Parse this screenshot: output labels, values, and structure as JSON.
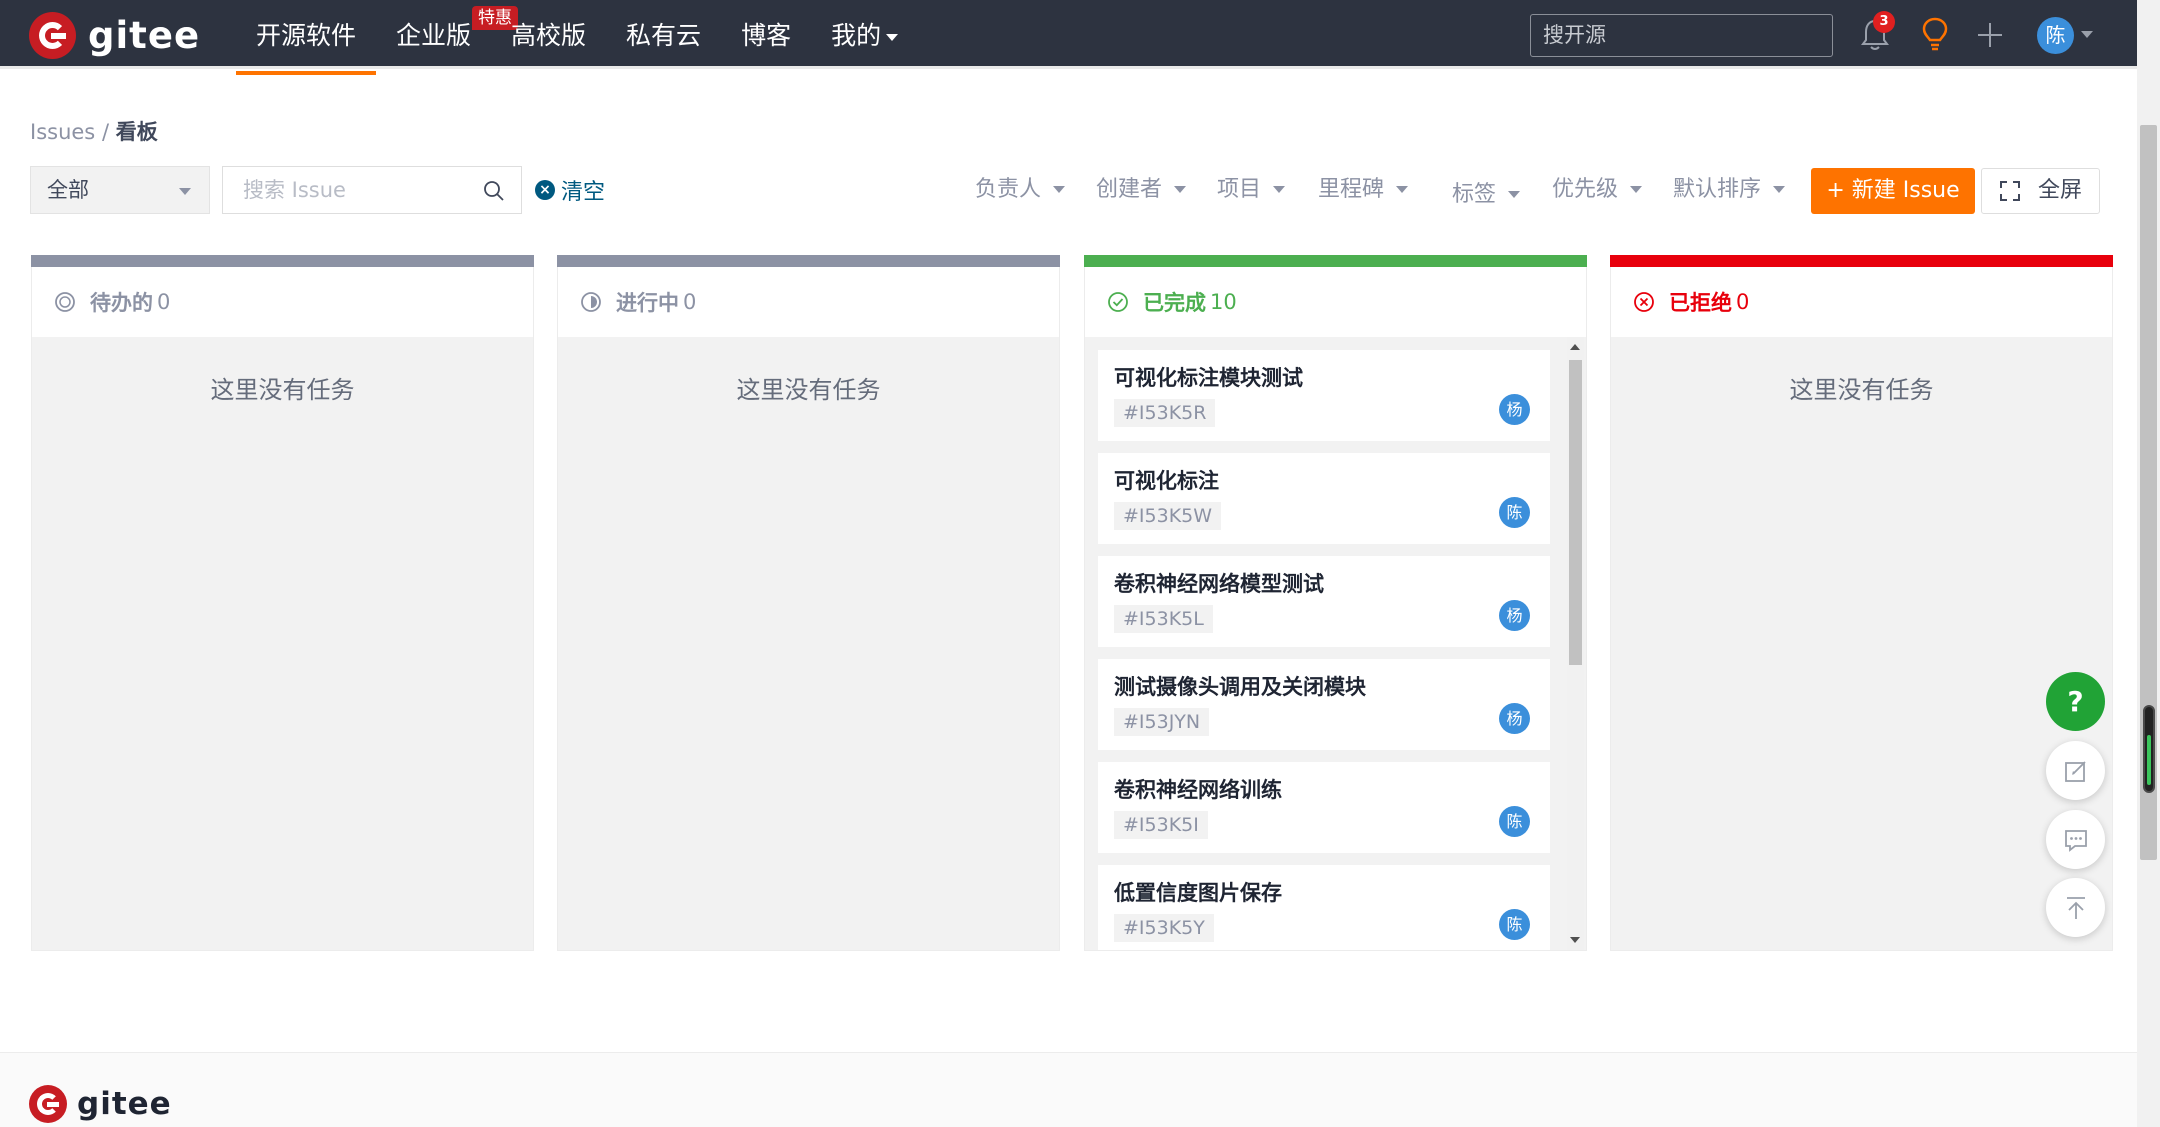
{
  "brand": {
    "name": "gitee"
  },
  "nav": [
    {
      "label": "开源软件",
      "active": true
    },
    {
      "label": "企业版",
      "badge": "特惠"
    },
    {
      "label": "高校版"
    },
    {
      "label": "私有云"
    },
    {
      "label": "博客"
    },
    {
      "label": "我的",
      "dropdown": true
    }
  ],
  "topbar": {
    "search_placeholder": "搜开源",
    "notification_count": "3",
    "user_avatar": "陈",
    "icons": [
      "bell-icon",
      "lightbulb-icon",
      "plus-icon"
    ]
  },
  "breadcrumb": {
    "parent": "Issues",
    "separator": "/",
    "current": "看板"
  },
  "filters": {
    "scope_value": "全部",
    "search_placeholder": "搜索 Issue",
    "clear_label": "清空",
    "dropdowns": [
      "负责人",
      "创建者",
      "项目",
      "里程碑",
      "标签",
      "优先级",
      "默认排序"
    ],
    "new_issue_label": "+ 新建 Issue",
    "fullscreen_label": "全屏"
  },
  "columns": [
    {
      "title": "待办的",
      "count": "0",
      "color": "#8c92a4",
      "empty_text": "这里没有任务",
      "icon": "todo-circle-icon"
    },
    {
      "title": "进行中",
      "count": "0",
      "color": "#8c92a4",
      "empty_text": "这里没有任务",
      "icon": "progress-half-circle-icon"
    },
    {
      "title": "已完成",
      "count": "10",
      "color": "#4caf50",
      "icon": "check-circle-icon",
      "cards": [
        {
          "title": "可视化标注模块测试",
          "id": "#I53K5R",
          "assignee": "杨"
        },
        {
          "title": "可视化标注",
          "id": "#I53K5W",
          "assignee": "陈"
        },
        {
          "title": "卷积神经网络模型测试",
          "id": "#I53K5L",
          "assignee": "杨"
        },
        {
          "title": "测试摄像头调用及关闭模块",
          "id": "#I53JYN",
          "assignee": "杨"
        },
        {
          "title": "卷积神经网络训练",
          "id": "#I53K5I",
          "assignee": "陈"
        },
        {
          "title": "低置信度图片保存",
          "id": "#I53K5Y",
          "assignee": "陈"
        }
      ]
    },
    {
      "title": "已拒绝",
      "count": "0",
      "color": "#e8000c",
      "empty_text": "这里没有任务",
      "icon": "reject-circle-icon"
    }
  ],
  "floating": {
    "help_label": "?"
  },
  "colors": {
    "topbar": "#2d3340",
    "accent": "#fe7300",
    "done": "#4caf50",
    "rejected": "#e8000c",
    "avatar": "#3b8fdb"
  }
}
